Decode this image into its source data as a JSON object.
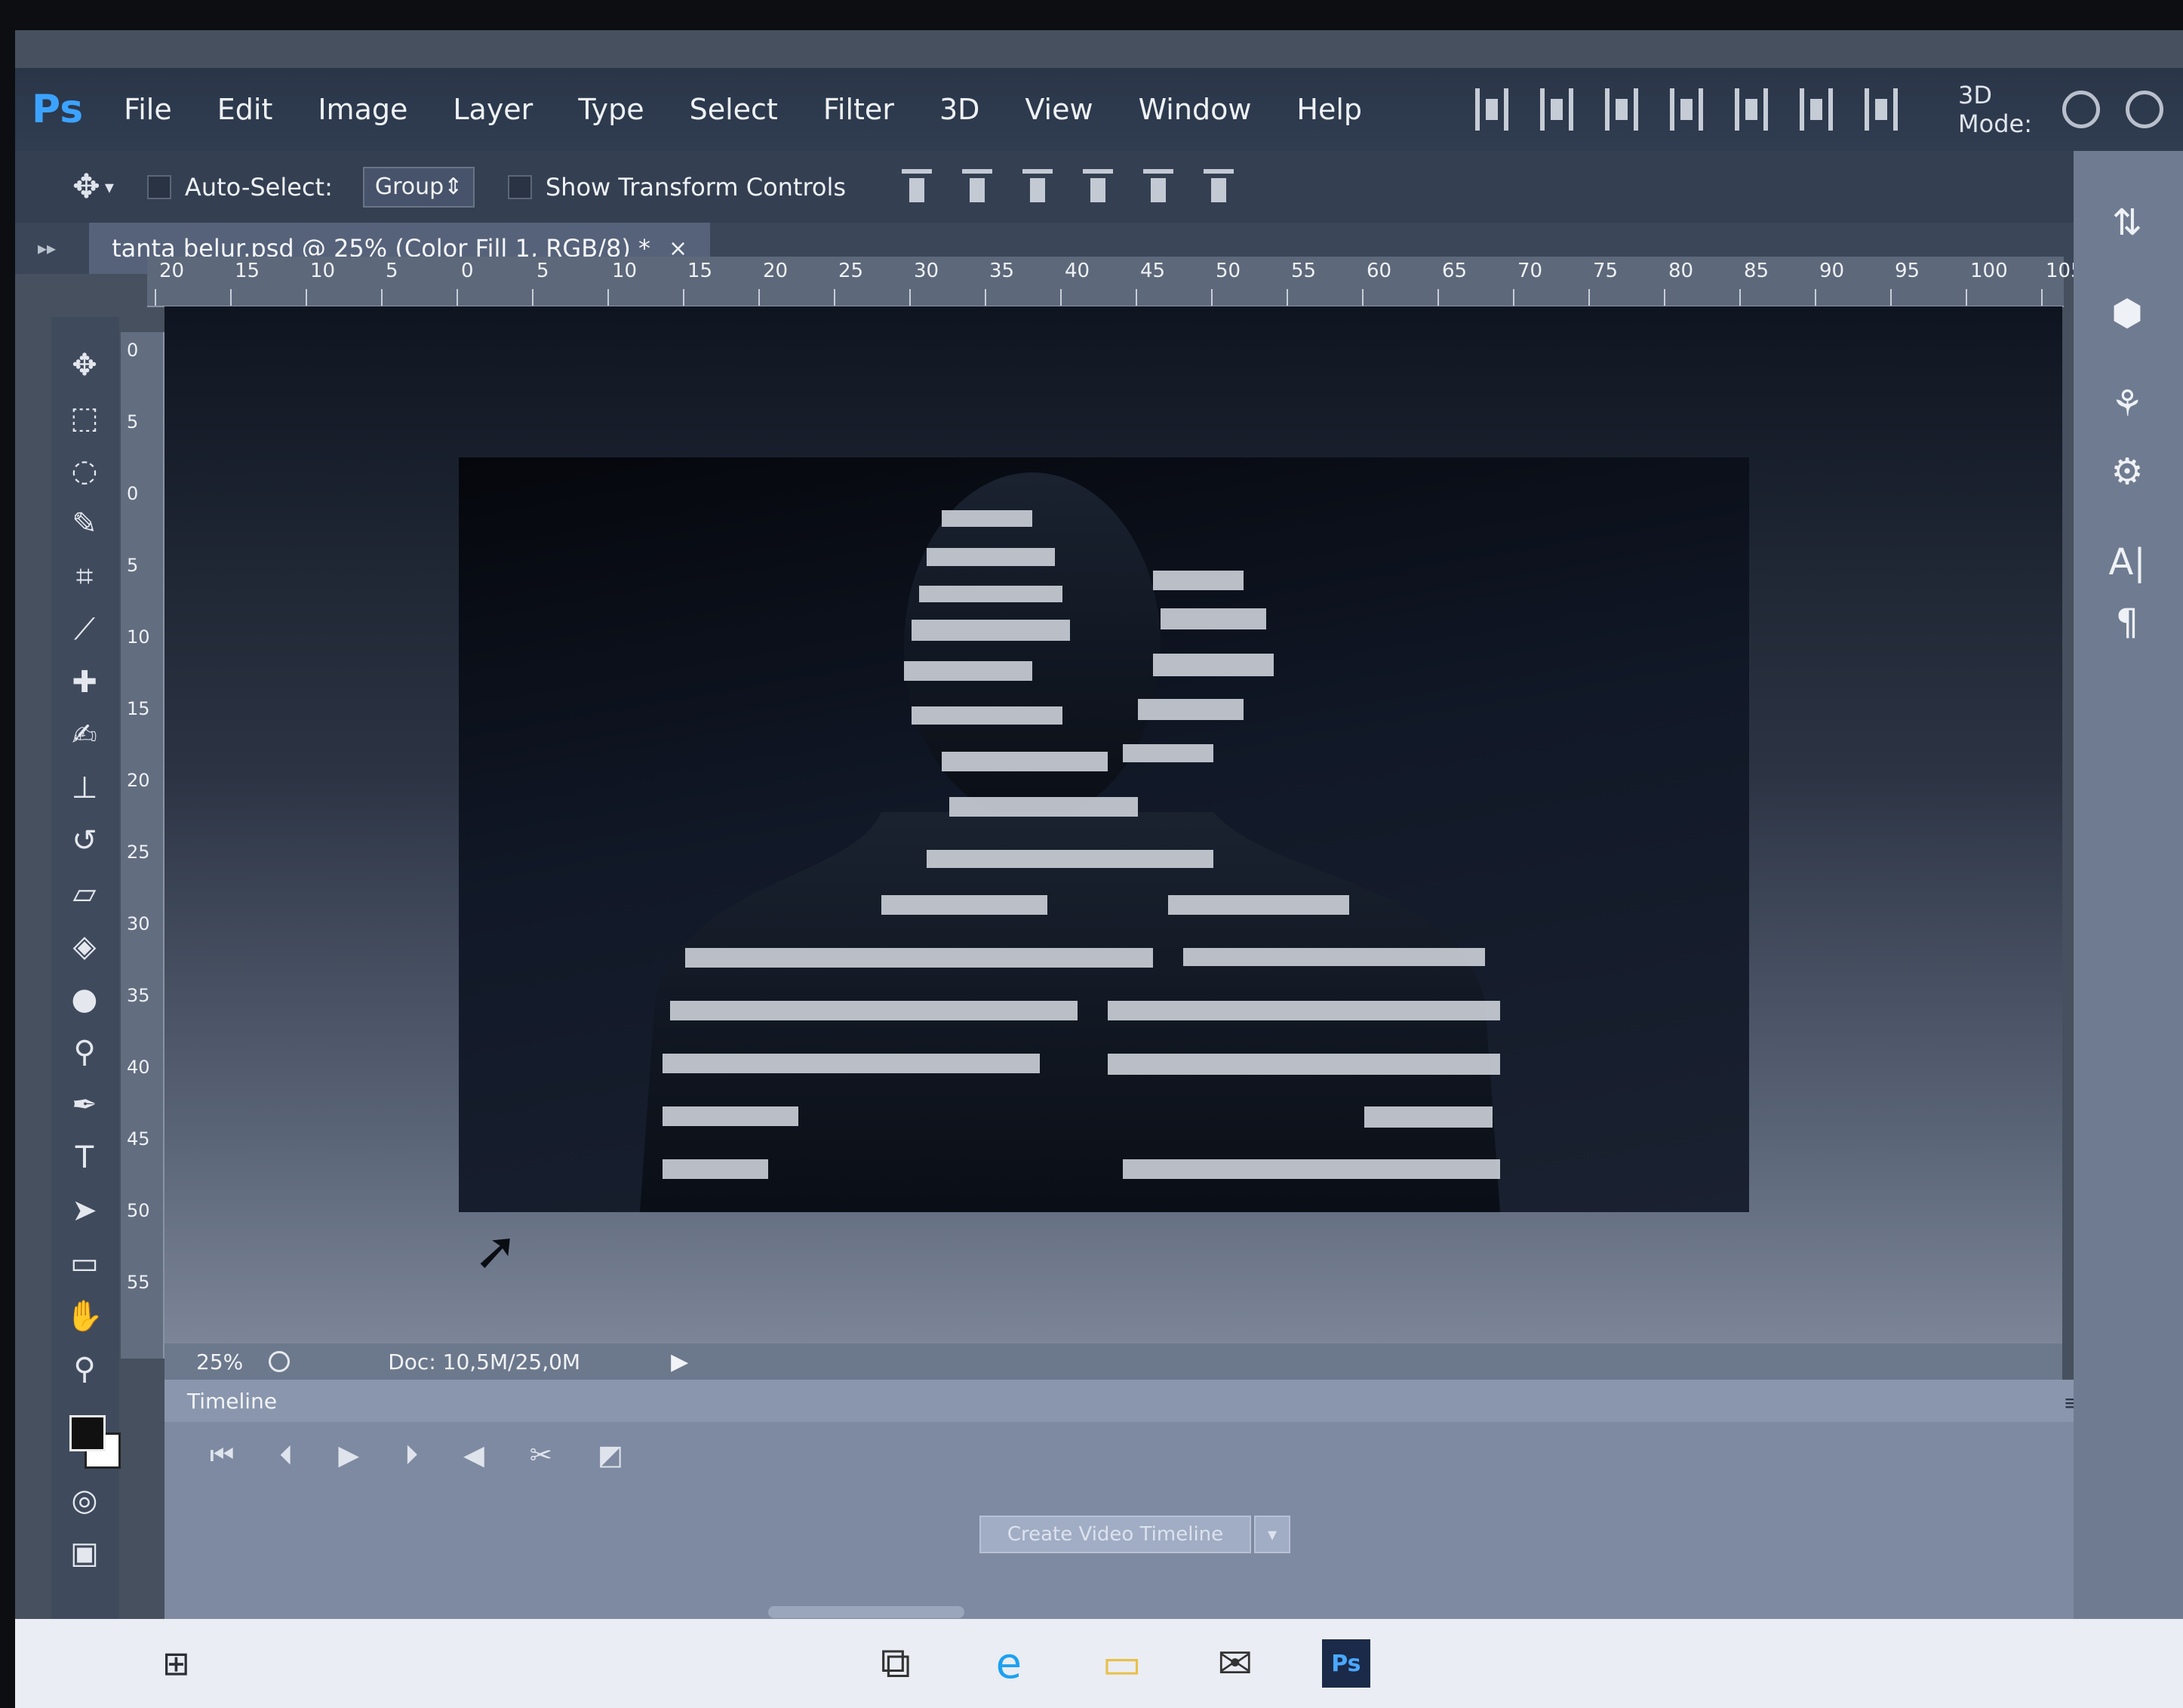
{
  "app": {
    "logo": "Ps",
    "menu": [
      "File",
      "Edit",
      "Image",
      "Layer",
      "Type",
      "Select",
      "Filter",
      "3D",
      "View",
      "Window",
      "Help"
    ],
    "mode_label": "3D Mode:"
  },
  "options": {
    "auto_select_label": "Auto-Select:",
    "group_value": "Group",
    "show_transform_label": "Show Transform Controls"
  },
  "document": {
    "tab_title": "tanta belur.psd @ 25% (Color Fill 1, RGB/8) *",
    "close_glyph": "×"
  },
  "ruler": {
    "top_labels": [
      "20",
      "15",
      "10",
      "5",
      "0",
      "5",
      "10",
      "15",
      "20",
      "25",
      "30",
      "35",
      "40",
      "45",
      "50",
      "55",
      "60",
      "65",
      "70",
      "75",
      "80",
      "85",
      "90",
      "95",
      "100",
      "105"
    ],
    "left_labels": [
      "0",
      "5",
      "0",
      "5",
      "10",
      "15",
      "20",
      "25",
      "30",
      "35",
      "40",
      "45",
      "50",
      "55"
    ]
  },
  "status": {
    "zoom": "25%",
    "doc_size": "Doc: 10,5M/25,0M"
  },
  "timeline": {
    "title": "Timeline",
    "create_button": "Create Video Timeline"
  },
  "right_panel": {
    "type_icon_text": "A|",
    "paragraph_icon_text": "¶"
  },
  "taskbar": {
    "ps_label": "Ps"
  },
  "colors": {
    "accent": "#3ba3ff",
    "foreground_color": "#111111",
    "background_color": "#ffffff"
  }
}
